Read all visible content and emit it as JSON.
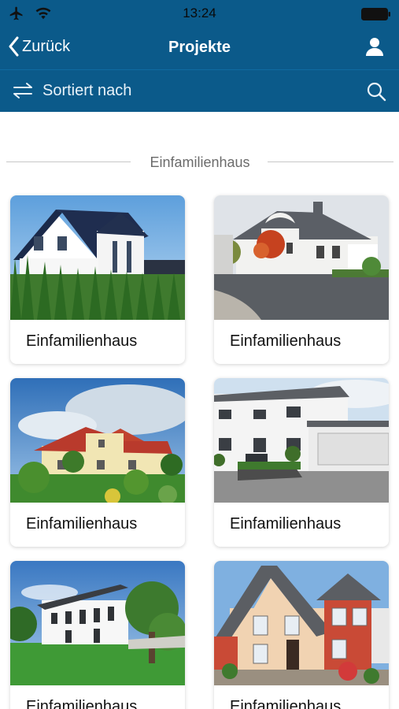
{
  "status": {
    "time": "13:24"
  },
  "nav": {
    "back_label": "Zurück",
    "title": "Projekte"
  },
  "sort": {
    "label": "Sortiert nach"
  },
  "section": {
    "title": "Einfamilienhaus"
  },
  "cards": [
    {
      "label": "Einfamilienhaus"
    },
    {
      "label": "Einfamilienhaus"
    },
    {
      "label": "Einfamilienhaus"
    },
    {
      "label": "Einfamilienhaus"
    },
    {
      "label": "Einfamilienhaus"
    },
    {
      "label": "Einfamilienhaus"
    }
  ],
  "colors": {
    "brand": "#0b5a8a",
    "text": "#111111",
    "muted": "#6b6b6b"
  },
  "icons": [
    "airplane-icon",
    "wifi-icon",
    "battery-icon",
    "chevron-left-icon",
    "user-icon",
    "sort-arrows-icon",
    "search-icon"
  ]
}
